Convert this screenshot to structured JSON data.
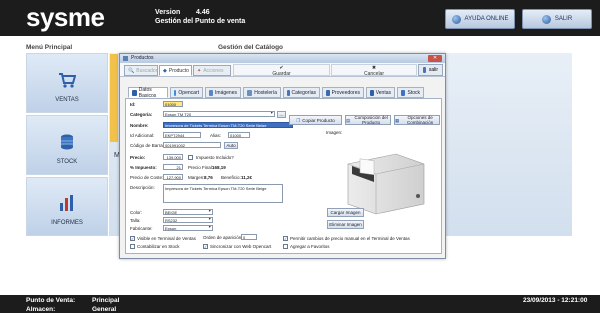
{
  "header": {
    "logo": "sysme",
    "version_label": "Version",
    "version_value": "4.46",
    "subtitle": "Gestión del Punto de venta",
    "help_button": "AYUDA ONLINE",
    "exit_button": "SALIR"
  },
  "menu": {
    "title": "Menú Principal",
    "tiles": [
      {
        "label": "VENTAS"
      },
      {
        "label": "STOCK"
      },
      {
        "label": "INFORMES"
      }
    ],
    "partial_letter": "M"
  },
  "catalog_title": "Gestión del Catálogo",
  "dialog": {
    "title": "Productos",
    "close": "salir",
    "tabs": {
      "buscar": "Buscador",
      "producto": "Producto",
      "acciones": "Acciones"
    },
    "toolbar": {
      "guardar": "Guardar",
      "cancelar": "Cancelar"
    },
    "subtabs": [
      "Datos Basicos",
      "Opencart",
      "Imágenes",
      "Hostelería",
      "Categorías",
      "Proveedores",
      "Ventas",
      "Stock"
    ],
    "fields": {
      "id_label": "Id:",
      "id_value": "01000",
      "categoria_label": "Categoría:",
      "categoria_value": "Epson TM T20",
      "nombre_label": "Nombre:",
      "nombre_value": "Impresora de Tickets Termica Epson TM-T20 Serie Beige",
      "idadicional_label": "Id Adicional:",
      "idadicional_value": "EKPT2944",
      "alias_label": "Alias:",
      "alias_value": "01000",
      "codigo_label": "Código de Barras:",
      "codigo_value": "001991002",
      "auto_button": "Auto",
      "precio_label": "Precio:",
      "precio_value": "139.000",
      "impuesto_incluido": "Impuesto Incluido?",
      "pct_impuesto_label": "% Impuesto:",
      "pct_impuesto_value": "21",
      "precio_final_label": "Precio Final:",
      "precio_final_value": "168,19",
      "precio_coste_label": "Precio de Coste:",
      "precio_coste_value": "127.900",
      "margen_label": "Margen:",
      "margen_value": "8,76",
      "beneficio_label": "Beneficio:",
      "beneficio_value": "11,2€",
      "descripcion_label": "Descripción:",
      "descripcion_value": "Impresora de Tickets Termica Epson TM-T20 Serie Beige",
      "color_label": "Color:",
      "color_value": "BEIGE",
      "talla_label": "Talla:",
      "talla_value": "RS232",
      "fabricante_label": "Fabricante:",
      "fabricante_value": "Epson"
    },
    "buttons": {
      "copiar": "Copiar Producto",
      "composicion": "Composición del Producto",
      "opciones": "Opciones de Combinación",
      "cargar": "Cargar Imagen",
      "eliminar": "Eliminar Imagen"
    },
    "imagen_label": "Imagen:",
    "checks": {
      "visible": "Visible en Terminal de Ventas",
      "orden_label": "Orden de aparición:",
      "orden_value": "0",
      "permitir": "Permitir cambios de precio manual en el Terminal de Ventas",
      "contabilizar": "Contabilizar en Stock",
      "sincronizar": "Sincronizar con Web Opencart",
      "favoritos": "Agregar a Favoritos"
    }
  },
  "status": {
    "punto_label": "Punto de Venta:",
    "punto_value": "Principal",
    "almacen_label": "Almacen:",
    "almacen_value": "General",
    "datetime": "23/09/2013 - 12:21:00"
  }
}
